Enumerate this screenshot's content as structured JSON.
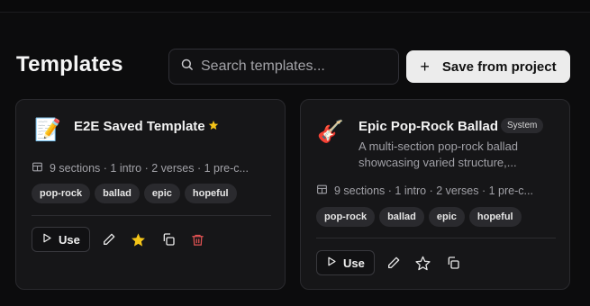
{
  "header": {
    "title": "Templates",
    "search_placeholder": "Search templates...",
    "search_icon": "search-icon",
    "save_label": "Save from project",
    "save_icon": "plus-icon"
  },
  "templates": [
    {
      "emoji": "📝",
      "title": "E2E Saved Template",
      "favorite": true,
      "badge": "",
      "description": "",
      "meta": "9 sections · 1 intro · 2 verses · 1 pre-c...",
      "tags": [
        "pop-rock",
        "ballad",
        "epic",
        "hopeful"
      ],
      "use_label": "Use",
      "actions": [
        "edit-icon",
        "star-filled-icon",
        "copy-icon",
        "trash-icon"
      ]
    },
    {
      "emoji": "🎸",
      "title": "Epic Pop-Rock Ballad",
      "favorite": false,
      "badge": "System",
      "description": "A multi-section pop-rock ballad showcasing varied structure,...",
      "meta": "9 sections · 1 intro · 2 verses · 1 pre-c...",
      "tags": [
        "pop-rock",
        "ballad",
        "epic",
        "hopeful"
      ],
      "use_label": "Use",
      "actions": [
        "edit-icon",
        "star-outline-icon",
        "copy-icon"
      ]
    }
  ],
  "colors": {
    "background": "#0c0c0d",
    "card": "#161618",
    "favorite_star": "#f5c518",
    "delete": "#e05252",
    "button_light": "#ececec"
  }
}
